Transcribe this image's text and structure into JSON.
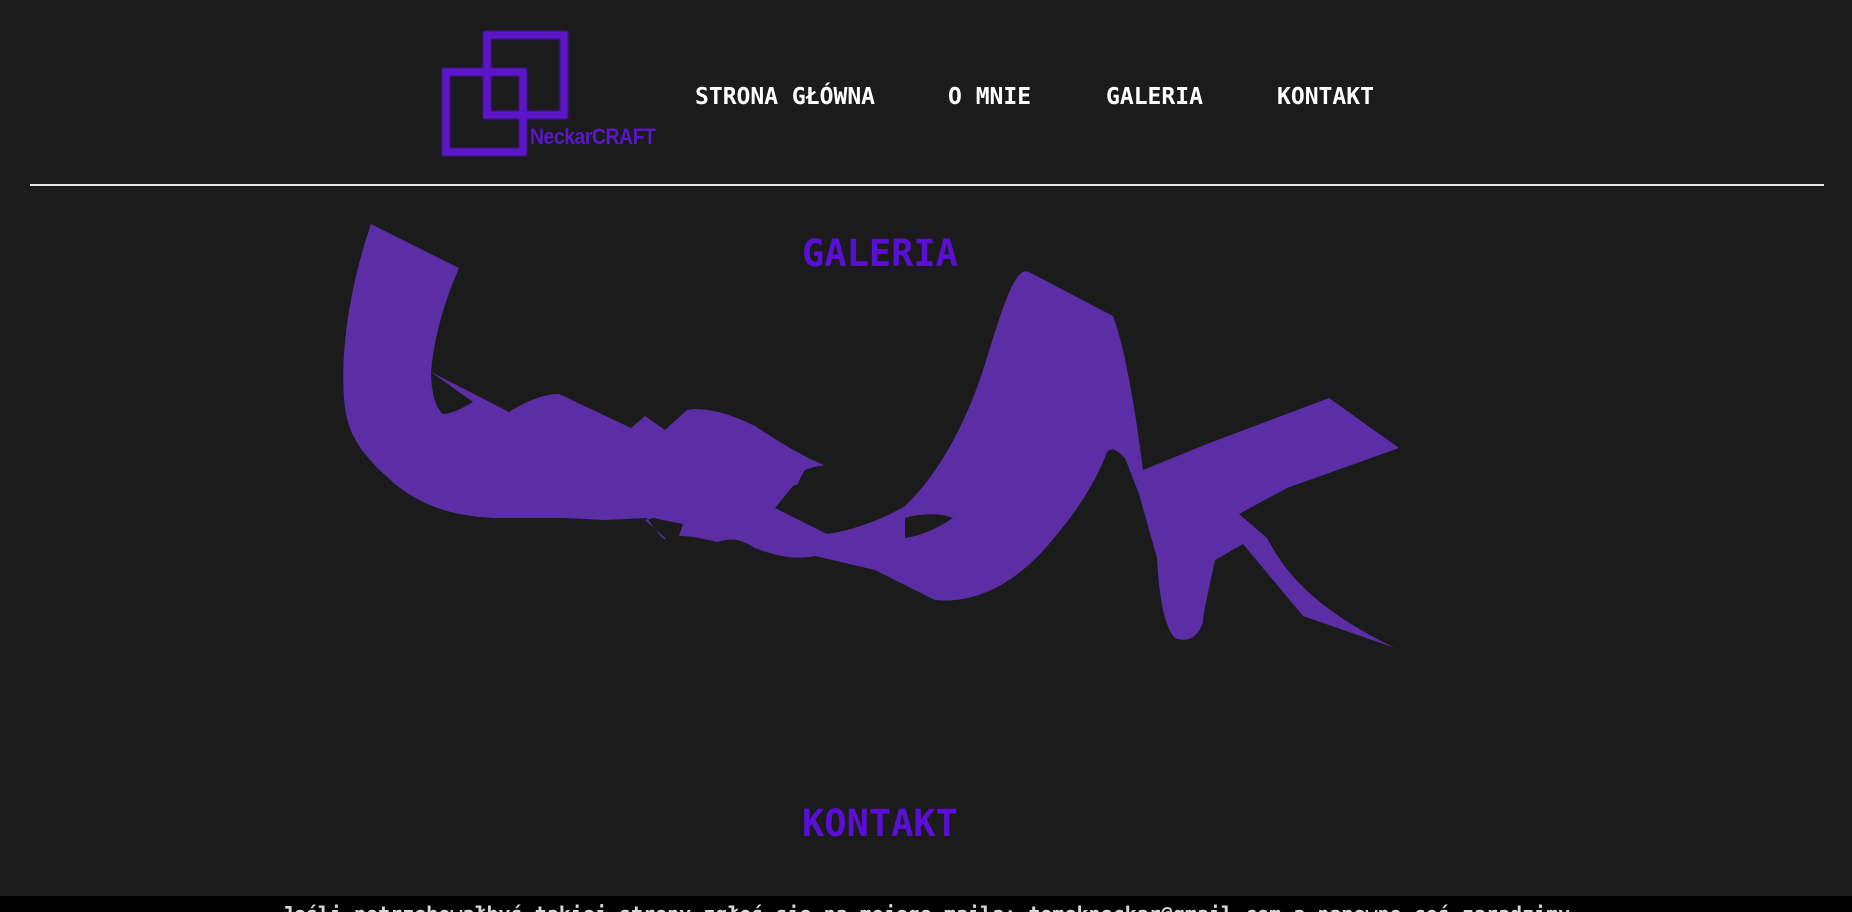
{
  "brand": {
    "logo_text": "NeckarCRAFT",
    "color": "#5b16c9"
  },
  "nav": {
    "items": [
      {
        "label": "STRONA GŁÓWNA"
      },
      {
        "label": "O MNIE"
      },
      {
        "label": "GALERIA"
      },
      {
        "label": "KONTAKT"
      }
    ]
  },
  "gallery": {
    "title": "GALERIA",
    "image": "graffiti-tag-artwork",
    "image_color": "#5c2ea6"
  },
  "contact": {
    "title": "KONTAKT",
    "text": "Jeśli potrzebowałbyś takiej strony zgłoś się na mojego maila: tomekneckar@gmail.com a napewno coś zaradzimy"
  },
  "colors": {
    "background": "#1b1b1b",
    "accent": "#5b0fd6",
    "nav_text": "#ffffff",
    "footer_bg": "#000000"
  }
}
